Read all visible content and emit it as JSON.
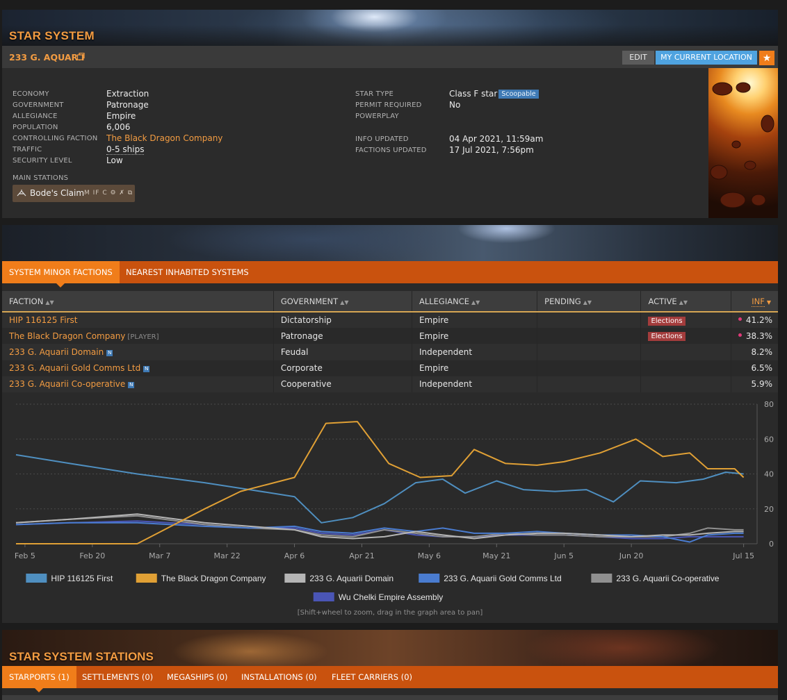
{
  "system": {
    "section_title": "STAR SYSTEM",
    "name": "233 G. AQUARII",
    "edit_label": "EDIT",
    "location_label": "MY CURRENT LOCATION",
    "left_info": [
      {
        "key": "ECONOMY",
        "value": "Extraction"
      },
      {
        "key": "GOVERNMENT",
        "value": "Patronage"
      },
      {
        "key": "ALLEGIANCE",
        "value": "Empire"
      },
      {
        "key": "POPULATION",
        "value": "6,006"
      },
      {
        "key": "CONTROLLING FACTION",
        "value": "The Black Dragon Company"
      },
      {
        "key": "TRAFFIC",
        "value": "0-5 ships"
      },
      {
        "key": "SECURITY LEVEL",
        "value": "Low"
      }
    ],
    "star_type_key": "STAR TYPE",
    "star_type_value": "Class F star",
    "scoopable_badge": "Scoopable",
    "permit_key": "PERMIT REQUIRED",
    "permit_value": "No",
    "powerplay_key": "POWERPLAY",
    "info_updated_key": "INFO UPDATED",
    "info_updated_value": "04 Apr 2021, 11:59am",
    "factions_updated_key": "FACTIONS UPDATED",
    "factions_updated_value": "17 Jul 2021, 7:56pm",
    "main_stations_label": "MAIN STATIONS",
    "main_station_name": "Bode's Claim",
    "main_station_services": "M IF C ⚙ ✗ ⧉"
  },
  "faction_tabs": {
    "minor": "SYSTEM MINOR FACTIONS",
    "nearest": "NEAREST INHABITED SYSTEMS"
  },
  "faction_table": {
    "headers": [
      "FACTION",
      "GOVERNMENT",
      "ALLEGIANCE",
      "PENDING",
      "ACTIVE",
      "INF"
    ],
    "rows": [
      {
        "faction": "HIP 116125 First",
        "tag": "",
        "badge": "",
        "government": "Dictatorship",
        "allegiance": "Empire",
        "pending": "",
        "active": "Elections",
        "inf": "41.2%"
      },
      {
        "faction": "The Black Dragon Company",
        "tag": "[PLAYER]",
        "badge": "",
        "government": "Patronage",
        "allegiance": "Empire",
        "pending": "",
        "active": "Elections",
        "inf": "38.3%"
      },
      {
        "faction": "233 G. Aquarii Domain",
        "tag": "",
        "badge": "N",
        "government": "Feudal",
        "allegiance": "Independent",
        "pending": "",
        "active": "",
        "inf": "8.2%"
      },
      {
        "faction": "233 G. Aquarii Gold Comms Ltd",
        "tag": "",
        "badge": "N",
        "government": "Corporate",
        "allegiance": "Empire",
        "pending": "",
        "active": "",
        "inf": "6.5%"
      },
      {
        "faction": "233 G. Aquarii Co-operative",
        "tag": "",
        "badge": "N",
        "government": "Cooperative",
        "allegiance": "Independent",
        "pending": "",
        "active": "",
        "inf": "5.9%"
      }
    ]
  },
  "chart_data": {
    "type": "line",
    "title": "",
    "xlabel": "",
    "ylabel": "",
    "x_ticks": [
      "Feb 5",
      "Feb 20",
      "Mar 7",
      "Mar 22",
      "Apr 6",
      "Apr 21",
      "May 6",
      "May 21",
      "Jun 5",
      "Jun 20",
      "Jul 15"
    ],
    "x_tick_days": [
      0,
      15,
      30,
      45,
      60,
      75,
      90,
      105,
      120,
      135,
      160
    ],
    "y_ticks": [
      0,
      20,
      40,
      60,
      80
    ],
    "ylim": [
      0,
      80
    ],
    "xlim_days": [
      -2,
      163
    ],
    "y_axis_side": "right",
    "grid": "horizontal dashed",
    "legend_position": "bottom",
    "series": [
      {
        "name": "HIP 116125 First",
        "color": "#4f8fc0",
        "points": [
          [
            -2,
            51
          ],
          [
            10,
            46
          ],
          [
            25,
            40
          ],
          [
            40,
            35
          ],
          [
            50,
            31
          ],
          [
            60,
            27
          ],
          [
            66,
            12
          ],
          [
            73,
            15
          ],
          [
            80,
            23
          ],
          [
            87,
            35
          ],
          [
            93,
            37
          ],
          [
            98,
            29
          ],
          [
            105,
            36
          ],
          [
            111,
            31
          ],
          [
            118,
            30
          ],
          [
            125,
            31
          ],
          [
            131,
            24
          ],
          [
            137,
            36
          ],
          [
            145,
            35
          ],
          [
            151,
            37
          ],
          [
            156,
            41
          ],
          [
            160,
            40
          ]
        ]
      },
      {
        "name": "The Black Dragon Company",
        "color": "#e0a035",
        "points": [
          [
            -2,
            0
          ],
          [
            25,
            0
          ],
          [
            40,
            20
          ],
          [
            48,
            30
          ],
          [
            60,
            38
          ],
          [
            67,
            69
          ],
          [
            74,
            70
          ],
          [
            81,
            46
          ],
          [
            88,
            38
          ],
          [
            95,
            39
          ],
          [
            100,
            54
          ],
          [
            107,
            46
          ],
          [
            114,
            45
          ],
          [
            120,
            47
          ],
          [
            128,
            52
          ],
          [
            136,
            60
          ],
          [
            142,
            50
          ],
          [
            148,
            52
          ],
          [
            152,
            43
          ],
          [
            158,
            43
          ],
          [
            160,
            38
          ]
        ]
      },
      {
        "name": "233 G. Aquarii Domain",
        "color": "#b5b5b5",
        "points": [
          [
            -2,
            12
          ],
          [
            10,
            14
          ],
          [
            25,
            17
          ],
          [
            40,
            12
          ],
          [
            50,
            10
          ],
          [
            60,
            8
          ],
          [
            66,
            4
          ],
          [
            73,
            3
          ],
          [
            80,
            4
          ],
          [
            87,
            7
          ],
          [
            93,
            5
          ],
          [
            100,
            3
          ],
          [
            107,
            5
          ],
          [
            114,
            6
          ],
          [
            120,
            6
          ],
          [
            128,
            5
          ],
          [
            135,
            4
          ],
          [
            142,
            5
          ],
          [
            148,
            5
          ],
          [
            152,
            6
          ],
          [
            158,
            7
          ],
          [
            160,
            7
          ]
        ]
      },
      {
        "name": "233 G. Aquarii Gold Comms Ltd",
        "color": "#4a7cd0",
        "points": [
          [
            -2,
            11
          ],
          [
            10,
            12
          ],
          [
            25,
            12
          ],
          [
            40,
            10
          ],
          [
            50,
            9
          ],
          [
            60,
            10
          ],
          [
            66,
            7
          ],
          [
            73,
            6
          ],
          [
            80,
            9
          ],
          [
            87,
            7
          ],
          [
            93,
            9
          ],
          [
            100,
            6
          ],
          [
            107,
            6
          ],
          [
            114,
            7
          ],
          [
            120,
            6
          ],
          [
            128,
            5
          ],
          [
            135,
            5
          ],
          [
            142,
            4
          ],
          [
            148,
            1
          ],
          [
            152,
            5
          ],
          [
            158,
            6
          ],
          [
            160,
            6
          ]
        ]
      },
      {
        "name": "233 G. Aquarii Co-operative",
        "color": "#909090",
        "points": [
          [
            -2,
            12
          ],
          [
            10,
            14
          ],
          [
            25,
            16
          ],
          [
            40,
            11
          ],
          [
            50,
            9
          ],
          [
            60,
            8
          ],
          [
            66,
            5
          ],
          [
            73,
            4
          ],
          [
            80,
            8
          ],
          [
            87,
            6
          ],
          [
            93,
            4
          ],
          [
            100,
            4
          ],
          [
            107,
            6
          ],
          [
            114,
            5
          ],
          [
            120,
            5
          ],
          [
            128,
            4
          ],
          [
            135,
            4
          ],
          [
            142,
            4
          ],
          [
            148,
            6
          ],
          [
            152,
            9
          ],
          [
            158,
            8
          ],
          [
            160,
            8
          ]
        ]
      },
      {
        "name": "Wu Chelki Empire Assembly",
        "color": "#4a55b5",
        "points": [
          [
            -2,
            11
          ],
          [
            10,
            12
          ],
          [
            25,
            13
          ],
          [
            40,
            11
          ],
          [
            50,
            9
          ],
          [
            60,
            9
          ],
          [
            66,
            6
          ],
          [
            73,
            5
          ],
          [
            80,
            8
          ],
          [
            87,
            5
          ],
          [
            93,
            4
          ],
          [
            100,
            4
          ],
          [
            107,
            5
          ],
          [
            114,
            5
          ],
          [
            120,
            5
          ],
          [
            128,
            4
          ],
          [
            135,
            3
          ],
          [
            142,
            3
          ],
          [
            148,
            4
          ],
          [
            152,
            4
          ],
          [
            158,
            4
          ],
          [
            160,
            4
          ]
        ]
      }
    ]
  },
  "chart_hint": "[Shift+wheel to zoom, drag in the graph area to pan]",
  "stations": {
    "section_title": "STAR SYSTEM STATIONS",
    "tabs": [
      "STARPORTS (1)",
      "SETTLEMENTS (0)",
      "MEGASHIPS (0)",
      "INSTALLATIONS (0)",
      "FLEET CARRIERS (0)"
    ]
  }
}
